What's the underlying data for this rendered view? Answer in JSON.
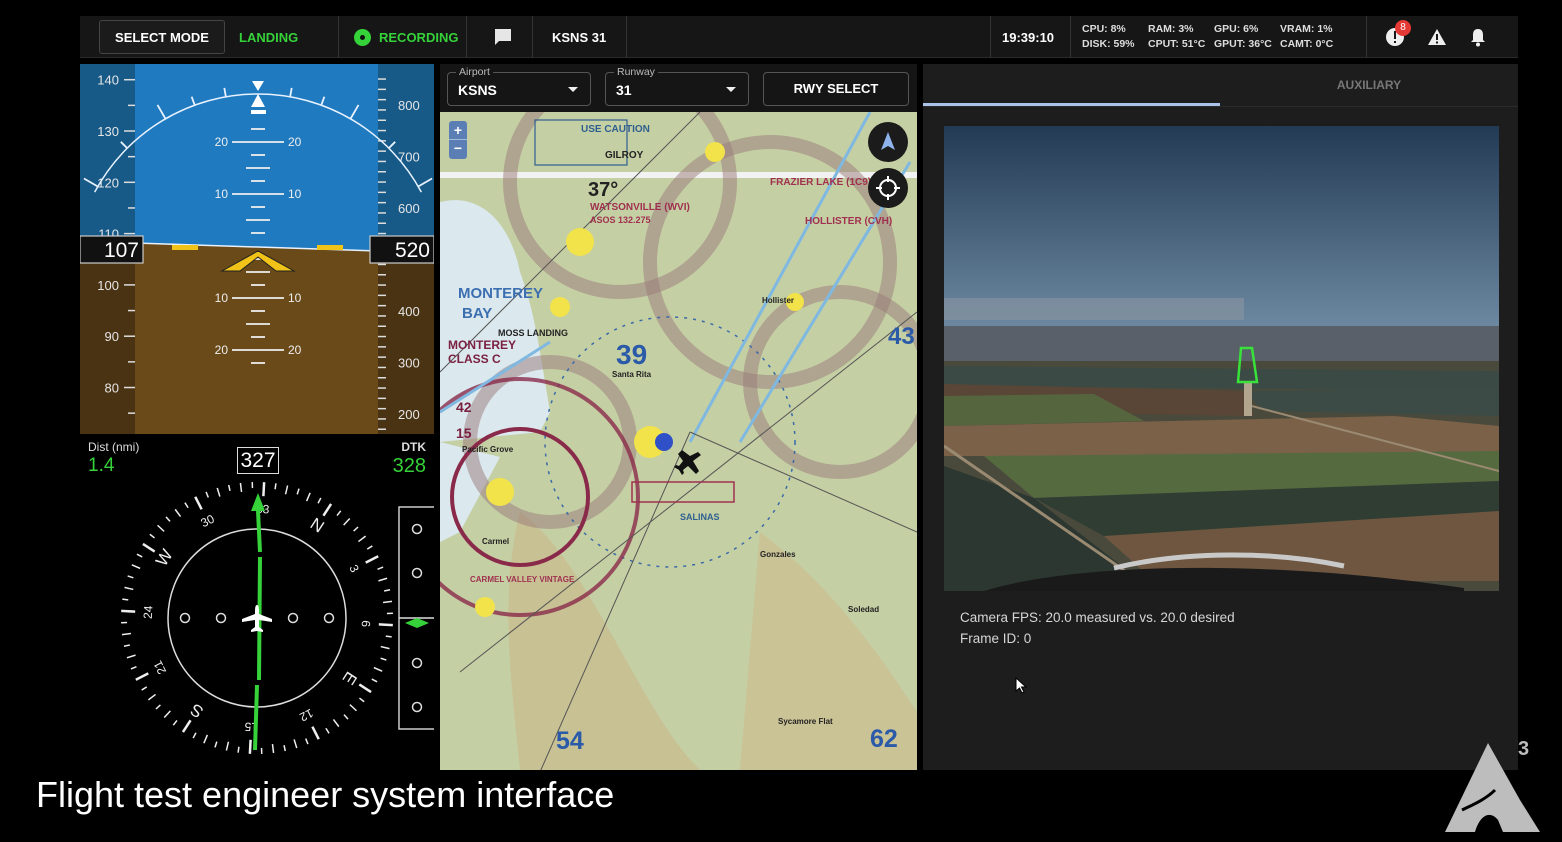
{
  "topbar": {
    "select_mode_label": "SELECT MODE",
    "mode": "LANDING",
    "recording_label": "RECORDING",
    "destination": "KSNS 31",
    "clock": "19:39:10",
    "stats": {
      "cpu": "CPU: 8%",
      "disk": "DISK: 59%",
      "ram": "RAM: 3%",
      "cput": "CPUT: 51°C",
      "gpu": "GPU: 6%",
      "gput": "GPUT: 36°C",
      "vram": "VRAM: 1%",
      "camt": "CAMT: 0°C"
    },
    "alert_count": "8",
    "icons": [
      "chat-icon",
      "alert-badge-icon",
      "warning-icon",
      "bell-icon"
    ]
  },
  "pfd": {
    "airspeed": "107",
    "altitude": "520",
    "speed_ticks": [
      "140",
      "130",
      "120",
      "110",
      "100",
      "90",
      "80"
    ],
    "alt_ticks": [
      "800",
      "700",
      "600",
      "400",
      "300",
      "200"
    ],
    "pitch_labels": [
      "20",
      "10",
      "10",
      "20"
    ]
  },
  "hsi": {
    "dist_label": "Dist (nmi)",
    "dist_value": "1.4",
    "dtk_label": "DTK",
    "dtk_value": "328",
    "heading": "327",
    "card_labels": [
      "N",
      "3",
      "6",
      "E",
      "12",
      "15",
      "S",
      "21",
      "24",
      "W",
      "30",
      "33"
    ]
  },
  "map_controls": {
    "airport_label": "Airport",
    "airport_value": "KSNS",
    "runway_label": "Runway",
    "runway_value": "31",
    "rwy_select_label": "RWY SELECT",
    "zoom_in": "+",
    "zoom_out": "−"
  },
  "map": {
    "labels": [
      {
        "t": "USE CAUTION",
        "c": "#2e5f8f"
      },
      {
        "t": "WATSONVILLE (WVI)",
        "c": "#a0304f"
      },
      {
        "t": "ASOS 132.275",
        "c": "#a0304f"
      },
      {
        "t": "MONTEREY",
        "c": "#3c6fb0"
      },
      {
        "t": "BAY",
        "c": "#3c6fb0"
      },
      {
        "t": "MONTEREY",
        "c": "#7a2040"
      },
      {
        "t": "CLASS C",
        "c": "#7a2040"
      },
      {
        "t": "MOSS LANDING",
        "c": "#222"
      },
      {
        "t": "39",
        "c": "#2a5aa8"
      },
      {
        "t": "43",
        "c": "#2a5aa8"
      },
      {
        "t": "42",
        "c": "#7a2040"
      },
      {
        "t": "15",
        "c": "#7a2040"
      },
      {
        "t": "54",
        "c": "#2a5aa8"
      },
      {
        "t": "62",
        "c": "#2a5aa8"
      },
      {
        "t": "FRAZIER LAKE (1C9)",
        "c": "#a0304f"
      },
      {
        "t": "HOLLISTER (CVH)",
        "c": "#a0304f"
      },
      {
        "t": "GILROY",
        "c": "#222"
      },
      {
        "t": "SALINAS",
        "c": "#2e5f8f"
      },
      {
        "t": "Hollister",
        "c": "#222"
      },
      {
        "t": "Carmel",
        "c": "#222"
      },
      {
        "t": "Pacific Grove",
        "c": "#222"
      },
      {
        "t": "CARMEL VALLEY VINTAGE",
        "c": "#a0304f"
      },
      {
        "t": "Santa Rita",
        "c": "#222"
      },
      {
        "t": "Gonzales",
        "c": "#222"
      },
      {
        "t": "Soledad",
        "c": "#222"
      },
      {
        "t": "Sycamore Flat",
        "c": "#222"
      },
      {
        "t": "37°",
        "c": "#222"
      }
    ]
  },
  "right_panel": {
    "tabs": [
      {
        "label": "",
        "active": true
      },
      {
        "label": "AUXILIARY",
        "active": false
      }
    ],
    "camera_fps": "Camera FPS: 20.0 measured vs. 20.0 desired",
    "frame_id": "Frame ID: 0",
    "detection_color": "#39e23a"
  },
  "caption": "Flight test engineer system interface",
  "logo_text": "3",
  "colors": {
    "accent_green": "#35d23a",
    "sky": "#1f7ac0",
    "ground": "#6a4a18",
    "tab_indicator": "#a9c4e8",
    "badge_red": "#e53935"
  }
}
